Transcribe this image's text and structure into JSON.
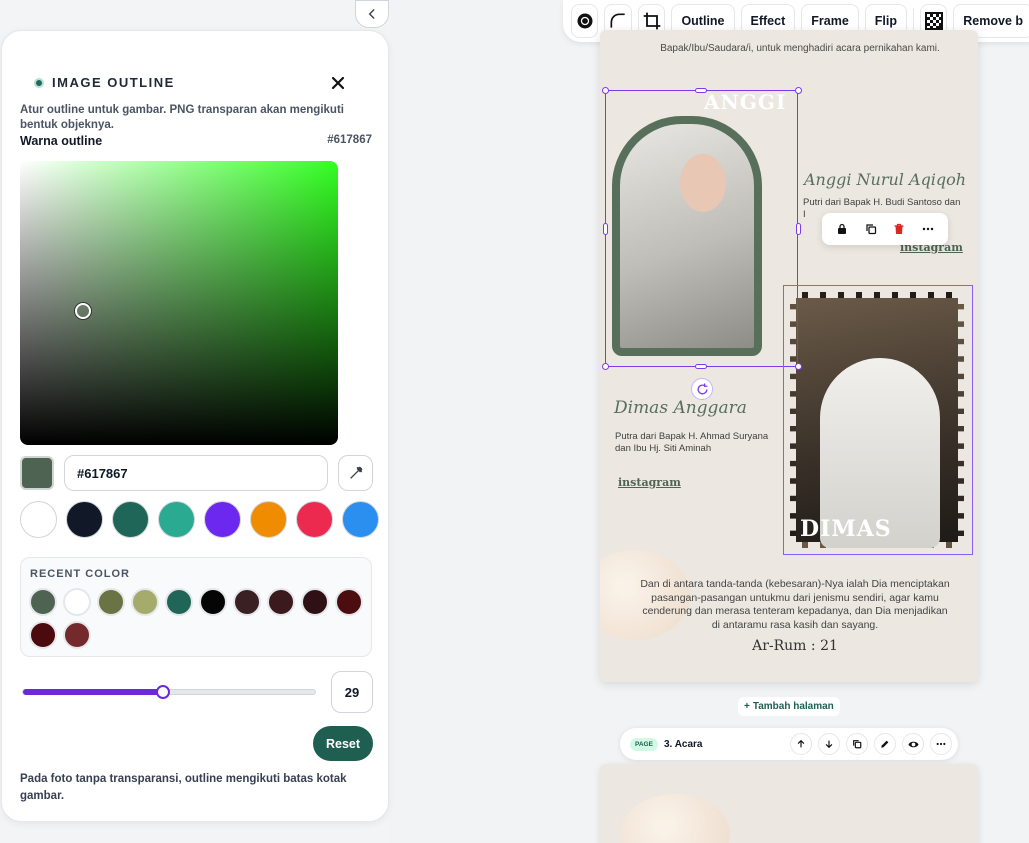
{
  "panel": {
    "title": "IMAGE OUTLINE",
    "description": "Atur outline untuk gambar. PNG transparan akan mengikuti bentuk objeknya.",
    "color_label": "Warna outline",
    "color_hex": "#617867",
    "hex_input_value": "#617867",
    "preset_colors": [
      "#ffffff",
      "#111827",
      "#1f6659",
      "#2aaa91",
      "#6d28f0",
      "#ef8c00",
      "#ec2a50",
      "#2b8ff0"
    ],
    "recent_title": "RECENT COLOR",
    "recent_colors": [
      "#4f6352",
      "#ffffff",
      "#6a7343",
      "#a5ab6a",
      "#1f6659",
      "#050505",
      "#3a1f23",
      "#3a1a1d",
      "#2f1115",
      "#4b0d10",
      "#4a0a0e",
      "#742a2c"
    ],
    "slider_value": "29",
    "slider_fraction": 0.48,
    "reset_label": "Reset",
    "footnote": "Pada foto tanpa transparansi, outline mengikuti batas kotak gambar."
  },
  "toolbar": {
    "outline_label": "Outline",
    "effect_label": "Effect",
    "frame_label": "Frame",
    "flip_label": "Flip",
    "remove_label": "Remove b"
  },
  "card": {
    "invite_text": "Bapak/Ibu/Saudara/i, untuk menghadiri acara pernikahan kami.",
    "bride_overlay": "ANGGI",
    "bride_name": "Anggi Nurul Aqiqoh",
    "bride_parents": "Putri dari Bapak H. Budi Santoso dan I",
    "bride_instagram": "instagram",
    "groom_name": "Dimas Anggara",
    "groom_parents": "Putra dari Bapak H. Ahmad Suryana dan Ibu Hj. Siti Aminah",
    "groom_instagram": "instagram",
    "groom_overlay": "DIMAS",
    "quote": "Dan di antara tanda-tanda (kebesaran)-Nya ialah Dia menciptakan pasangan-pasangan untukmu dari jenismu sendiri, agar kamu cenderung dan merasa tenteram kepadanya, dan Dia menjadikan di antaramu rasa kasih dan sayang.",
    "verse": "Ar-Rum : 21"
  },
  "add_page_label": "Tambah halaman",
  "page_bar": {
    "tag": "PAGE",
    "name": "3. Acara"
  }
}
